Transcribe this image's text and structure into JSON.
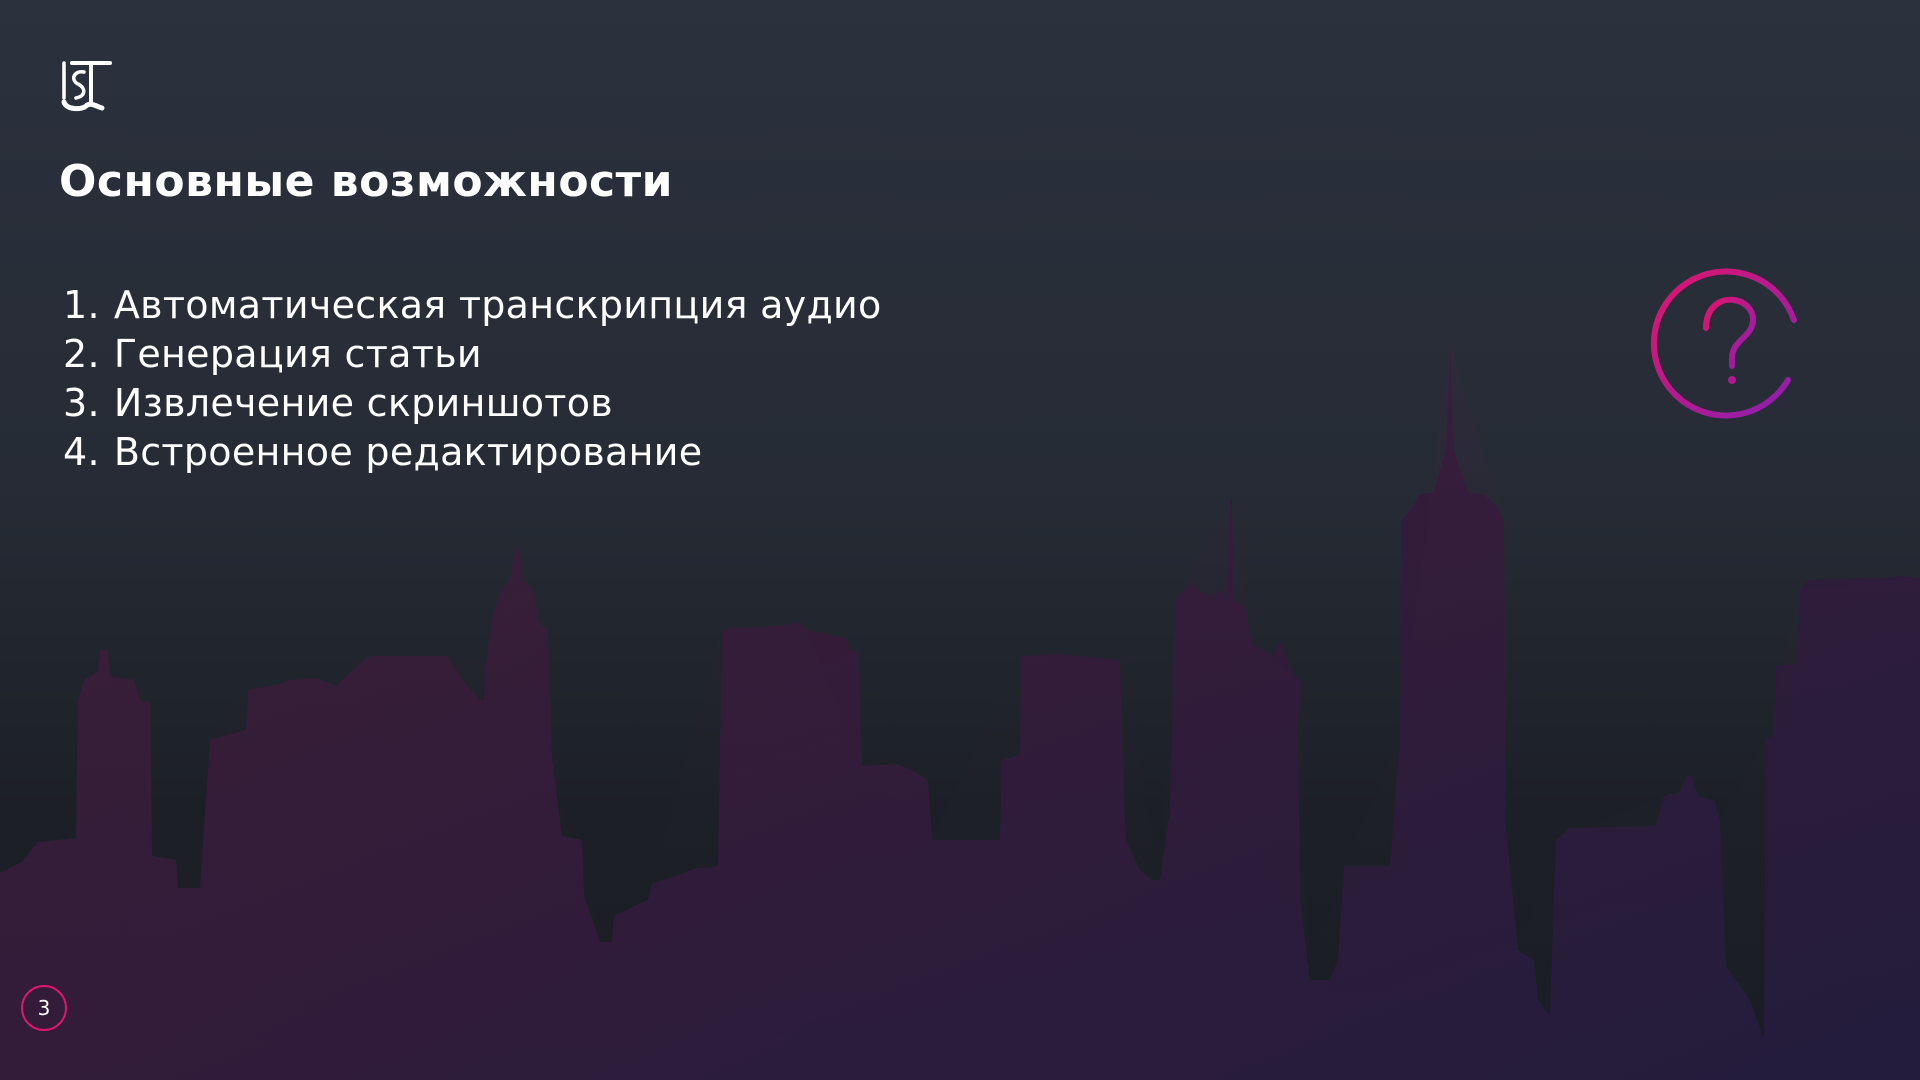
{
  "slide": {
    "title": "Основные возможности",
    "page_number": "3"
  },
  "features": [
    {
      "number": "1.",
      "label": "Автоматическая транскрипция аудио"
    },
    {
      "number": "2.",
      "label": "Генерация статьи"
    },
    {
      "number": "3.",
      "label": "Извлечение скриншотов"
    },
    {
      "number": "4.",
      "label": "Встроенное редактирование"
    }
  ],
  "icons": {
    "logo": "logo-icon",
    "question": "question-circle-icon"
  },
  "colors": {
    "accent_pink": "#e0156e",
    "accent_purple": "#8a1fb0",
    "skyline_left": "#3a1f33",
    "skyline_right": "#2a1f45",
    "text": "#ffffff"
  }
}
